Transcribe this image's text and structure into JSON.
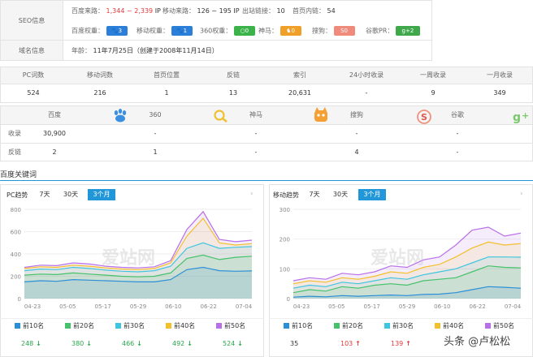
{
  "seo": {
    "label": "SEO信息",
    "baidu_traffic_label": "百度来路：",
    "baidu_traffic_value": "1,344 ~ 2,339",
    "baidu_traffic_unit": "IP",
    "mobile_traffic_label": "移动来路：",
    "mobile_traffic_value": "126 ~ 195 IP",
    "outlinks_label": "出站链接：",
    "outlinks_value": "10",
    "inlinks_label": "首页内链：",
    "inlinks_value": "54",
    "baidu_weight_label": "百度权重：",
    "baidu_weight_value": "3",
    "mobile_weight_label": "移动权重：",
    "mobile_weight_value": "1",
    "w360_label": "360权重：",
    "w360_value": "0",
    "shenma_label": "神马：",
    "shenma_value": "0",
    "sogou_label": "搜狗：",
    "sogou_value": "0",
    "google_label": "谷歌PR：",
    "google_value": "2"
  },
  "domain": {
    "label": "域名信息",
    "age_label": "年龄：",
    "age_value": "11年7月25日（创建于2008年11月14日）"
  },
  "stats": {
    "headers": [
      "PC词数",
      "移动词数",
      "首页位置",
      "反链",
      "索引",
      "24小时收录",
      "一周收录",
      "一月收录"
    ],
    "values": [
      "524",
      "216",
      "1",
      "13",
      "20,631",
      "-",
      "9",
      "349"
    ]
  },
  "engines": {
    "headers": [
      "百度",
      "360",
      "神马",
      "搜狗",
      "谷歌"
    ],
    "rows": [
      {
        "label": "收录",
        "values": [
          "30,900",
          "-",
          "-",
          "-",
          "-"
        ]
      },
      {
        "label": "反链",
        "values": [
          "2",
          "1",
          "-",
          "4",
          "-"
        ]
      }
    ]
  },
  "keywords_title": "百度关键词",
  "pc_panel": {
    "title": "PC趋势",
    "tabs": [
      "7天",
      "30天",
      "3个月"
    ],
    "active_tab": 2,
    "watermark": "爱站网",
    "legend": [
      "前10名",
      "前20名",
      "前30名",
      "前40名",
      "前50名"
    ],
    "values": [
      "248",
      "380",
      "466",
      "492",
      "524"
    ],
    "trend": [
      "down",
      "down",
      "down",
      "down",
      "down"
    ]
  },
  "mobile_panel": {
    "title": "移动趋势",
    "tabs": [
      "7天",
      "30天",
      "3个月"
    ],
    "active_tab": 2,
    "watermark": "爱站网",
    "legend": [
      "前10名",
      "前20名",
      "前30名",
      "前40名",
      "前50名"
    ],
    "values": [
      "35",
      "103",
      "139",
      "",
      ""
    ],
    "trend": [
      "none",
      "up",
      "up",
      "",
      ""
    ]
  },
  "footer_watermark": "头条 @卢松松",
  "colors": {
    "top10": "#2b8fd8",
    "top20": "#45c26a",
    "top30": "#3ec6e0",
    "top40": "#f2c02a",
    "top50": "#b86fe8"
  },
  "chart_data": [
    {
      "type": "area",
      "title": "PC趋势",
      "x_ticks": [
        "04-23",
        "05-05",
        "05-17",
        "05-29",
        "06-10",
        "06-22",
        "07-04"
      ],
      "ylim": [
        0,
        800
      ],
      "y_ticks": [
        0,
        200,
        400,
        600,
        800
      ],
      "series": [
        {
          "name": "前10名",
          "values": [
            150,
            160,
            155,
            170,
            165,
            160,
            155,
            150,
            150,
            170,
            260,
            280,
            250,
            245,
            248
          ]
        },
        {
          "name": "前20名",
          "values": [
            210,
            220,
            215,
            230,
            220,
            210,
            200,
            195,
            200,
            230,
            360,
            390,
            350,
            370,
            380
          ]
        },
        {
          "name": "前30名",
          "values": [
            250,
            265,
            260,
            280,
            270,
            255,
            245,
            240,
            250,
            290,
            450,
            500,
            450,
            460,
            466
          ]
        },
        {
          "name": "前40名",
          "values": [
            270,
            285,
            280,
            300,
            290,
            275,
            265,
            260,
            270,
            320,
            560,
            720,
            500,
            480,
            492
          ]
        },
        {
          "name": "前50名",
          "values": [
            280,
            300,
            295,
            320,
            310,
            290,
            280,
            275,
            285,
            340,
            620,
            780,
            530,
            510,
            524
          ]
        }
      ]
    },
    {
      "type": "area",
      "title": "移动趋势",
      "x_ticks": [
        "04-23",
        "05-05",
        "05-17",
        "05-29",
        "06-10",
        "06-22",
        "07-04"
      ],
      "ylim": [
        0,
        300
      ],
      "y_ticks": [
        0,
        100,
        200,
        300
      ],
      "series": [
        {
          "name": "前10名",
          "values": [
            5,
            8,
            6,
            10,
            8,
            10,
            12,
            10,
            14,
            15,
            20,
            30,
            40,
            38,
            35
          ]
        },
        {
          "name": "前20名",
          "values": [
            20,
            30,
            25,
            40,
            35,
            45,
            50,
            45,
            60,
            65,
            70,
            90,
            110,
            105,
            103
          ]
        },
        {
          "name": "前30名",
          "values": [
            35,
            45,
            40,
            55,
            50,
            60,
            70,
            65,
            80,
            90,
            100,
            120,
            140,
            140,
            139
          ]
        },
        {
          "name": "前40名",
          "values": [
            50,
            60,
            55,
            70,
            65,
            75,
            90,
            85,
            105,
            115,
            140,
            170,
            190,
            180,
            185
          ]
        },
        {
          "name": "前50名",
          "values": [
            60,
            70,
            65,
            85,
            80,
            90,
            110,
            105,
            130,
            140,
            180,
            230,
            240,
            210,
            220
          ]
        }
      ]
    }
  ]
}
